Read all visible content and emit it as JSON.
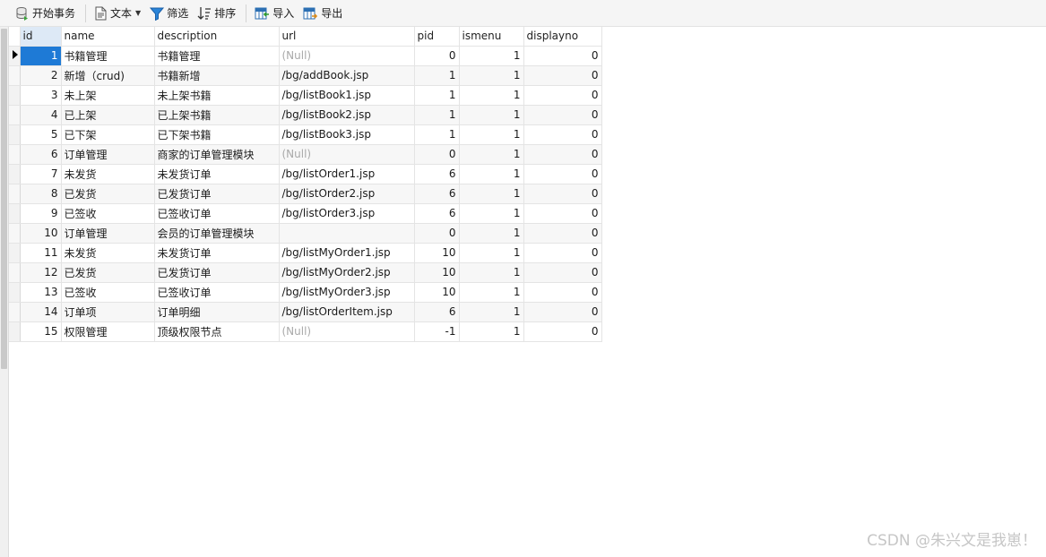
{
  "toolbar": {
    "begin_transaction": "开始事务",
    "text": "文本",
    "filter": "筛选",
    "sort": "排序",
    "import": "导入",
    "export": "导出"
  },
  "columns": [
    "id",
    "name",
    "description",
    "url",
    "pid",
    "ismenu",
    "displayno"
  ],
  "rows": [
    [
      "1",
      "书籍管理",
      "书籍管理",
      "(Null)",
      "0",
      "1",
      "0"
    ],
    [
      "2",
      "新增（crud)",
      "书籍新增",
      "/bg/addBook.jsp",
      "1",
      "1",
      "0"
    ],
    [
      "3",
      "未上架",
      "未上架书籍",
      "/bg/listBook1.jsp",
      "1",
      "1",
      "0"
    ],
    [
      "4",
      "已上架",
      "已上架书籍",
      "/bg/listBook2.jsp",
      "1",
      "1",
      "0"
    ],
    [
      "5",
      "已下架",
      "已下架书籍",
      "/bg/listBook3.jsp",
      "1",
      "1",
      "0"
    ],
    [
      "6",
      "订单管理",
      "商家的订单管理模块",
      "(Null)",
      "0",
      "1",
      "0"
    ],
    [
      "7",
      "未发货",
      "未发货订单",
      "/bg/listOrder1.jsp",
      "6",
      "1",
      "0"
    ],
    [
      "8",
      "已发货",
      "已发货订单",
      "/bg/listOrder2.jsp",
      "6",
      "1",
      "0"
    ],
    [
      "9",
      "已签收",
      "已签收订单",
      "/bg/listOrder3.jsp",
      "6",
      "1",
      "0"
    ],
    [
      "10",
      "订单管理",
      "会员的订单管理模块",
      "",
      "0",
      "1",
      "0"
    ],
    [
      "11",
      "未发货",
      "未发货订单",
      "/bg/listMyOrder1.jsp",
      "10",
      "1",
      "0"
    ],
    [
      "12",
      "已发货",
      "已发货订单",
      "/bg/listMyOrder2.jsp",
      "10",
      "1",
      "0"
    ],
    [
      "13",
      "已签收",
      "已签收订单",
      "/bg/listMyOrder3.jsp",
      "10",
      "1",
      "0"
    ],
    [
      "14",
      "订单项",
      "订单明细",
      "/bg/listOrderItem.jsp",
      "6",
      "1",
      "0"
    ],
    [
      "15",
      "权限管理",
      "顶级权限节点",
      "(Null)",
      "-1",
      "1",
      "0"
    ]
  ],
  "watermark": "CSDN @朱兴文是我崽！"
}
